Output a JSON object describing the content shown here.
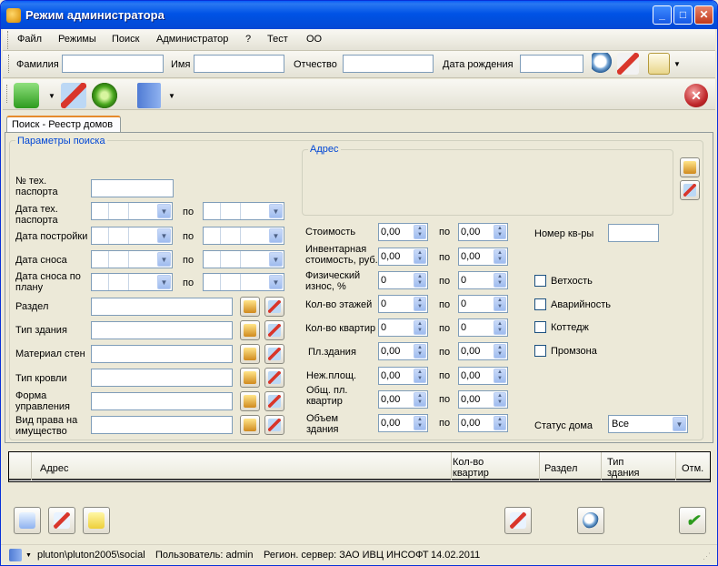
{
  "window": {
    "title": "Режим администратора"
  },
  "menu": [
    "Файл",
    "Режимы",
    "Поиск",
    "Администратор",
    "?",
    "Тест",
    "ОО"
  ],
  "searchbar": {
    "surname": "Фамилия",
    "name": "Имя",
    "patronymic": "Отчество",
    "birthdate": "Дата рождения"
  },
  "tab": "Поиск - Реестр домов",
  "params": {
    "group_title": "Параметры поиска",
    "tech_passport": "№ тех. паспорта",
    "tech_passport_date": "Дата тех. паспорта",
    "build_date": "Дата постройки",
    "demolition_date": "Дата сноса",
    "planned_demolition": "Дата сноса по плану",
    "po": "по",
    "section": "Раздел",
    "building_type": "Тип здания",
    "wall_material": "Материал стен",
    "roof_type": "Тип кровли",
    "management_form": "Форма управления",
    "property_right": "Вид права на имущество"
  },
  "address": {
    "title": "Адрес"
  },
  "numeric": {
    "cost": "Стоимость",
    "inventory_cost": "Инвентарная стоимость, руб.",
    "wear": "Физический износ, %",
    "floors": "Кол-во этажей",
    "apartments": "Кол-во квартир",
    "building_area": "Пл.здания",
    "nonres_area": "Неж.площ.",
    "total_area": "Общ. пл. квартир",
    "volume": "Объем здания",
    "po": "по",
    "values": {
      "cost_from": "0,00",
      "cost_to": "0,00",
      "inv_from": "0,00",
      "inv_to": "0,00",
      "wear_from": "0",
      "wear_to": "0",
      "floors_from": "0",
      "floors_to": "0",
      "apts_from": "0",
      "apts_to": "0",
      "area_from": "0,00",
      "area_to": "0,00",
      "nonres_from": "0,00",
      "nonres_to": "0,00",
      "total_from": "0,00",
      "total_to": "0,00",
      "volume_from": "0,00",
      "volume_to": "0,00"
    }
  },
  "right": {
    "apt_number": "Номер кв-ры",
    "dilapidation": "Ветхость",
    "emergency": "Аварийность",
    "cottage": "Коттедж",
    "industrial": "Промзона",
    "status_label": "Статус дома",
    "status_value": "Все"
  },
  "grid": {
    "columns": [
      "Адрес",
      "Кол-во квартир",
      "Раздел",
      "Тип здания",
      "Отм."
    ]
  },
  "statusbar": {
    "path": "pluton\\pluton2005\\social",
    "user": "Пользователь: admin",
    "server": "Регион. сервер: ЗАО ИВЦ ИНСОФТ",
    "date": "14.02.2011"
  }
}
